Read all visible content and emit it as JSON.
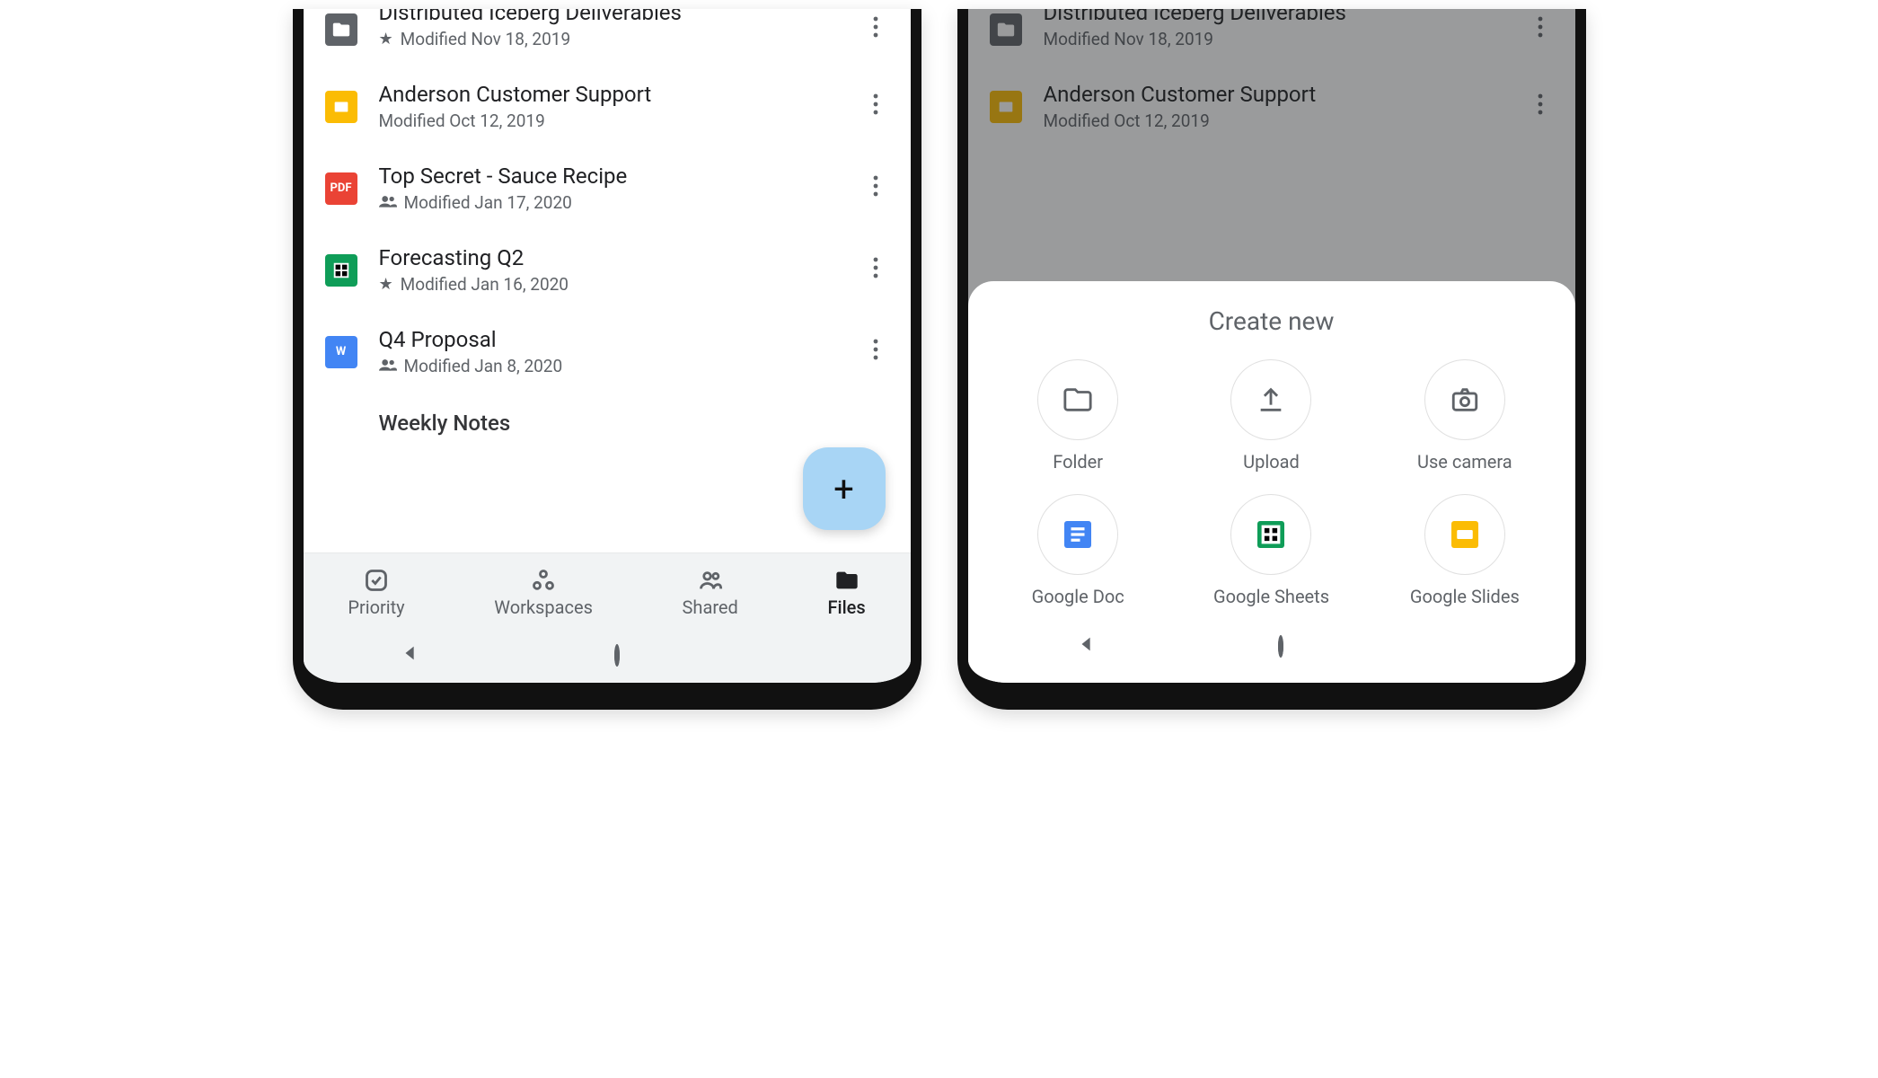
{
  "left": {
    "files": [
      {
        "icon": "folder",
        "title": "Distributed Iceberg Deliverables",
        "starred": true,
        "shared": false,
        "meta": "Modified Nov 18, 2019"
      },
      {
        "icon": "slides",
        "title": "Anderson Customer Support",
        "starred": false,
        "shared": false,
        "meta": "Modified Oct 12, 2019"
      },
      {
        "icon": "pdf",
        "title": "Top Secret - Sauce Recipe",
        "starred": false,
        "shared": true,
        "meta": "Modified Jan 17, 2020"
      },
      {
        "icon": "sheets",
        "title": "Forecasting Q2",
        "starred": true,
        "shared": false,
        "meta": "Modified Jan 16, 2020"
      },
      {
        "icon": "docs",
        "title": "Q4 Proposal",
        "starred": false,
        "shared": true,
        "meta": "Modified Jan 8, 2020"
      },
      {
        "icon": "docs",
        "title": "Weekly Notes",
        "starred": false,
        "shared": false,
        "meta": ""
      }
    ],
    "fab_label": "+",
    "nav": [
      {
        "key": "priority",
        "label": "Priority"
      },
      {
        "key": "workspaces",
        "label": "Workspaces"
      },
      {
        "key": "shared",
        "label": "Shared"
      },
      {
        "key": "files",
        "label": "Files"
      }
    ],
    "active_nav": "files"
  },
  "right": {
    "bg_files": [
      {
        "icon": "folder",
        "title": "Distributed Iceberg Deliverables",
        "meta": "Modified Nov 18, 2019"
      },
      {
        "icon": "slides",
        "title": "Anderson Customer Support",
        "meta": "Modified Oct 12, 2019"
      }
    ],
    "sheet_title": "Create new",
    "options": [
      {
        "key": "folder",
        "label": "Folder"
      },
      {
        "key": "upload",
        "label": "Upload"
      },
      {
        "key": "camera",
        "label": "Use camera"
      },
      {
        "key": "gdoc",
        "label": "Google Doc"
      },
      {
        "key": "gsheet",
        "label": "Google Sheets"
      },
      {
        "key": "gslide",
        "label": "Google Slides"
      }
    ]
  }
}
